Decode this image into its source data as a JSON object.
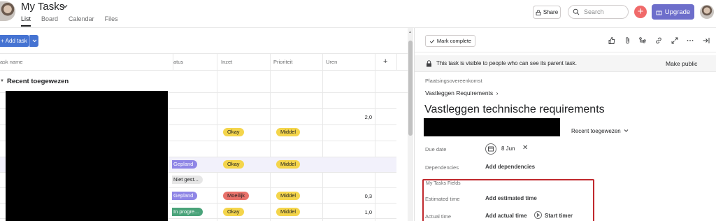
{
  "header": {
    "title": "My Tasks",
    "tabs": [
      "List",
      "Board",
      "Calendar",
      "Files"
    ],
    "active_tab": "List",
    "share_label": "Share",
    "search_placeholder": "Search",
    "upgrade_label": "Upgrade"
  },
  "list": {
    "add_task_label": "Add task",
    "columns": [
      "ask name",
      "atus",
      "Inzet",
      "Prioriteit",
      "Uren",
      "+"
    ],
    "section_title": "Recent toegewezen",
    "rows": [
      {
        "status": "",
        "inzet": "",
        "prioriteit": "",
        "uren": ""
      },
      {
        "status": "",
        "inzet": "",
        "prioriteit": "",
        "uren": "2,0"
      },
      {
        "status": "",
        "inzet": "Okay",
        "prioriteit": "Middel",
        "uren": ""
      },
      {
        "status": "",
        "inzet": "",
        "prioriteit": "",
        "uren": ""
      },
      {
        "status": "Gepland",
        "inzet": "Okay",
        "prioriteit": "Middel",
        "uren": ""
      },
      {
        "status": "Niet gest...",
        "inzet": "",
        "prioriteit": "",
        "uren": ""
      },
      {
        "status": "Gepland",
        "inzet": "Moeilijk",
        "prioriteit": "Middel",
        "uren": "0,3"
      },
      {
        "status": "In progre...",
        "inzet": "Okay",
        "prioriteit": "Middel",
        "uren": "1,0"
      }
    ],
    "colors": {
      "gepland": "#8f86e6",
      "niet_gestart": "#e6e6e6",
      "in_progress": "#4aa37a",
      "okay": "#f4d54b",
      "moeilijk": "#e8716a",
      "middel": "#f4d54b"
    }
  },
  "detail": {
    "mark_complete_label": "Mark complete",
    "notice": "This task is visible to people who can see its parent task.",
    "make_public_label": "Make public",
    "parent_project": "Plaatsingsovereenkomst",
    "parent_task": "Vastleggen Requirements",
    "parent_task_chevron": "›",
    "task_title": "Vastleggen technische requirements",
    "section_select": "Recent toegewezen",
    "due_date_label": "Due date",
    "due_date_value": "8 Jun",
    "dependencies_label": "Dependencies",
    "add_dependencies": "Add dependencies",
    "my_fields_title": "My Tasks Fields",
    "estimated_time_label": "Estimated time",
    "add_estimated_time": "Add estimated time",
    "actual_time_label": "Actual time",
    "add_actual_time": "Add actual time",
    "start_timer": "Start timer"
  }
}
